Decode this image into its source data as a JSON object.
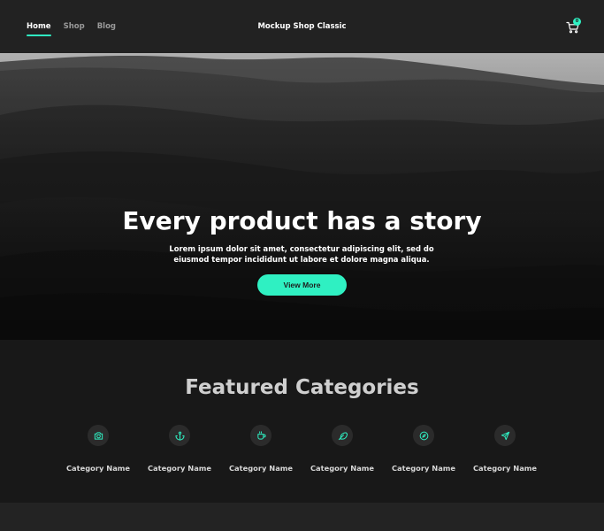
{
  "header": {
    "nav": [
      {
        "label": "Home",
        "active": true
      },
      {
        "label": "Shop",
        "active": false
      },
      {
        "label": "Blog",
        "active": false
      }
    ],
    "brand": "Mockup Shop Classic",
    "cart_icon": "cart-icon",
    "cart_count": "0"
  },
  "hero": {
    "title": "Every product has a story",
    "subtitle": "Lorem ipsum dolor sit amet, consectetur adipiscing elit, sed do eiusmod tempor incididunt ut labore et dolore magna aliqua.",
    "button_label": "View More"
  },
  "featured": {
    "title": "Featured Categories",
    "categories": [
      {
        "label": "Category Name",
        "icon": "camera-icon"
      },
      {
        "label": "Category Name",
        "icon": "anchor-icon"
      },
      {
        "label": "Category Name",
        "icon": "coffee-icon"
      },
      {
        "label": "Category Name",
        "icon": "feather-icon"
      },
      {
        "label": "Category Name",
        "icon": "compass-icon"
      },
      {
        "label": "Category Name",
        "icon": "send-icon"
      }
    ]
  },
  "colors": {
    "accent": "#2ff0c2",
    "header_bg": "#222222",
    "section_bg": "#181818"
  }
}
